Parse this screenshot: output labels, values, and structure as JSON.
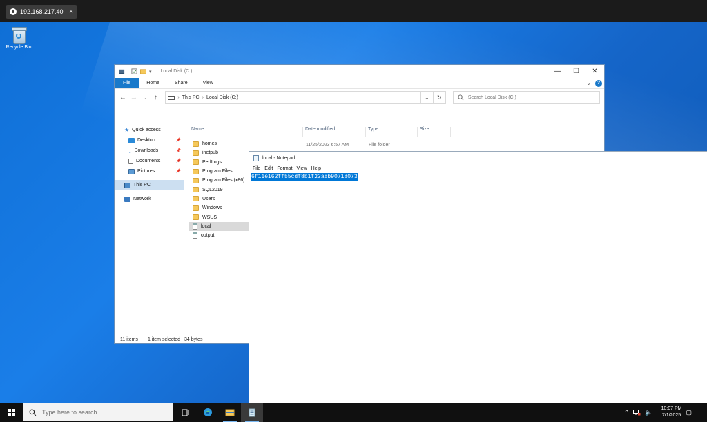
{
  "rdp": {
    "tab_title": "192.168.217.40",
    "close_glyph": "×"
  },
  "desktop": {
    "recycle_bin_label": "Recycle Bin"
  },
  "explorer": {
    "title": "Local Disk (C:)",
    "ribbon_tabs": [
      "File",
      "Home",
      "Share",
      "View"
    ],
    "breadcrumb": [
      "This PC",
      "Local Disk (C:)"
    ],
    "search_placeholder": "Search Local Disk (C:)",
    "nav": [
      {
        "label": "Quick access",
        "icon": "star-icon"
      },
      {
        "label": "Desktop",
        "icon": "desktop-folder-icon",
        "pinned": true
      },
      {
        "label": "Downloads",
        "icon": "download-icon",
        "pinned": true
      },
      {
        "label": "Documents",
        "icon": "documents-icon",
        "pinned": true
      },
      {
        "label": "Pictures",
        "icon": "pictures-icon",
        "pinned": true
      },
      {
        "label": "This PC",
        "icon": "computer-icon",
        "selected": true
      },
      {
        "label": "Network",
        "icon": "network-icon"
      }
    ],
    "columns": {
      "name": "Name",
      "date": "Date modified",
      "type": "Type",
      "size": "Size"
    },
    "files": [
      {
        "name": "homes",
        "kind": "folder"
      },
      {
        "name": "inetpub",
        "kind": "folder"
      },
      {
        "name": "PerfLogs",
        "kind": "folder"
      },
      {
        "name": "Program Files",
        "kind": "folder"
      },
      {
        "name": "Program Files (x86)",
        "kind": "folder"
      },
      {
        "name": "SQL2019",
        "kind": "folder"
      },
      {
        "name": "Users",
        "kind": "folder"
      },
      {
        "name": "Windows",
        "kind": "folder"
      },
      {
        "name": "WSUS",
        "kind": "folder"
      },
      {
        "name": "local",
        "kind": "text",
        "selected": true
      },
      {
        "name": "output",
        "kind": "text"
      }
    ],
    "first_row_date": "11/25/2023 6:57 AM",
    "first_row_type": "File folder",
    "status": {
      "items": "11 items",
      "selected": "1 item selected",
      "size": "34 bytes"
    }
  },
  "notepad": {
    "title": "local - Notepad",
    "menu": [
      "File",
      "Edit",
      "Format",
      "View",
      "Help"
    ],
    "content": "6f11e162ff55cdf8b1f23a8b90718073"
  },
  "taskbar": {
    "search_placeholder": "Type here to search",
    "time": "10:07 PM",
    "date": "7/1/2025"
  }
}
